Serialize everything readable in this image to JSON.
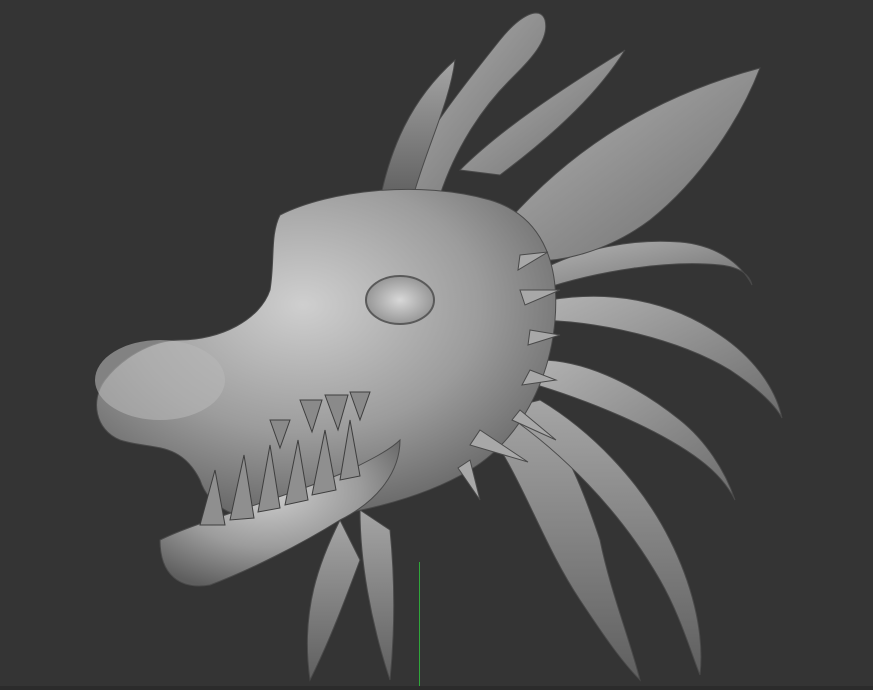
{
  "viewport": {
    "background": "#343434",
    "axis_color": "#2fa83a",
    "model": "dragon-head-sculpt",
    "material": "gray-clay"
  }
}
